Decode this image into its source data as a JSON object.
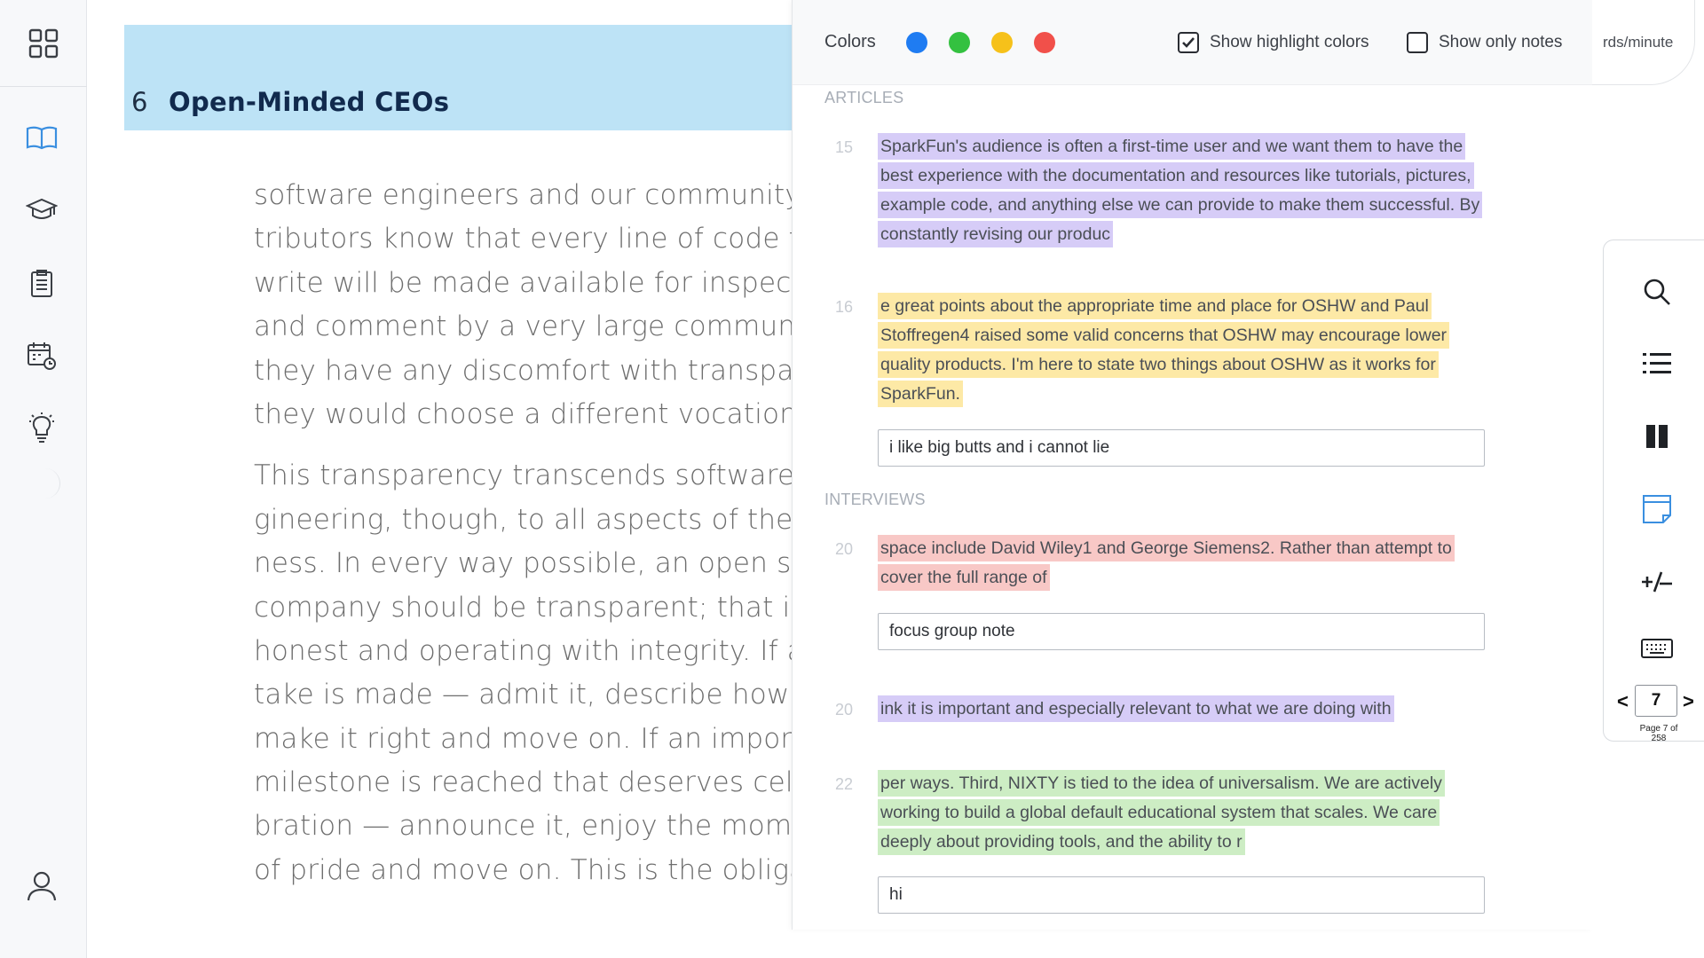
{
  "book": {
    "chapter_number": "6",
    "chapter_title": "Open-Minded CEOs",
    "paragraphs": [
      [
        "software engineers and our community con-",
        "tributors know that every line of code they",
        "write will be made available for inspection",
        "and comment by a very large community. If",
        "they have any discomfort with transparency,",
        "they would choose a different vocation."
      ],
      [
        "This transparency transcends software en-",
        "gineering, though, to all aspects of the busi-",
        "ness. In every way possible, an open source",
        "company should be transparent; that is, frank,",
        "honest and operating with integrity. If a mis-",
        "take is made — admit it, describe how you'll",
        "make it right and move on. If an important",
        "milestone is reached that deserves cele-",
        "bration — announce it, enjoy the moment",
        "of pride and move on. This is the obligation"
      ]
    ]
  },
  "panel": {
    "colors_label": "Colors",
    "colors": [
      "#1f7cf2",
      "#34c140",
      "#f6c11a",
      "#f1504a"
    ],
    "show_highlight_label": "Show highlight colors",
    "show_highlight_checked": true,
    "show_notes_label": "Show only notes",
    "show_notes_checked": false,
    "sections": [
      {
        "label": "ARTICLES",
        "items": [
          {
            "num": "15",
            "color": "purple",
            "text": "SparkFun's audience is often a first-time user and we want them to have the best experience with the documentation and resources like tutorials, pictures, example code, and anything else we can provide to make them successful. By constantly revising our produc",
            "note": null
          },
          {
            "num": "16",
            "color": "yellow",
            "text": "e great points about the appropriate time and place for OSHW and Paul Stoffregen4 raised some valid concerns that OSHW may encourage lower quality products. I'm here to state two things about OSHW as it works for SparkFun.",
            "note": "i like big butts and i cannot lie"
          }
        ]
      },
      {
        "label": "INTERVIEWS",
        "items": [
          {
            "num": "20",
            "color": "red",
            "text": "space include David Wiley1 and George Siemens2. Rather than attempt to cover the full range of",
            "note": "focus group note"
          },
          {
            "num": "20",
            "color": "purple",
            "text": "ink it is important and especially relevant to what we are doing with",
            "note": null
          },
          {
            "num": "22",
            "color": "green",
            "text": "per ways. Third, NIXTY is tied to the idea of universalism. We are actively working to build a global default educational system that scales. We care deeply about providing tools, and the ability to r",
            "note": "hi"
          }
        ]
      }
    ]
  },
  "right": {
    "wpm_label": "rds/minute",
    "page_prev": "<",
    "page_next": ">",
    "page_value": "7",
    "page_of": "Page 7 of 258"
  }
}
